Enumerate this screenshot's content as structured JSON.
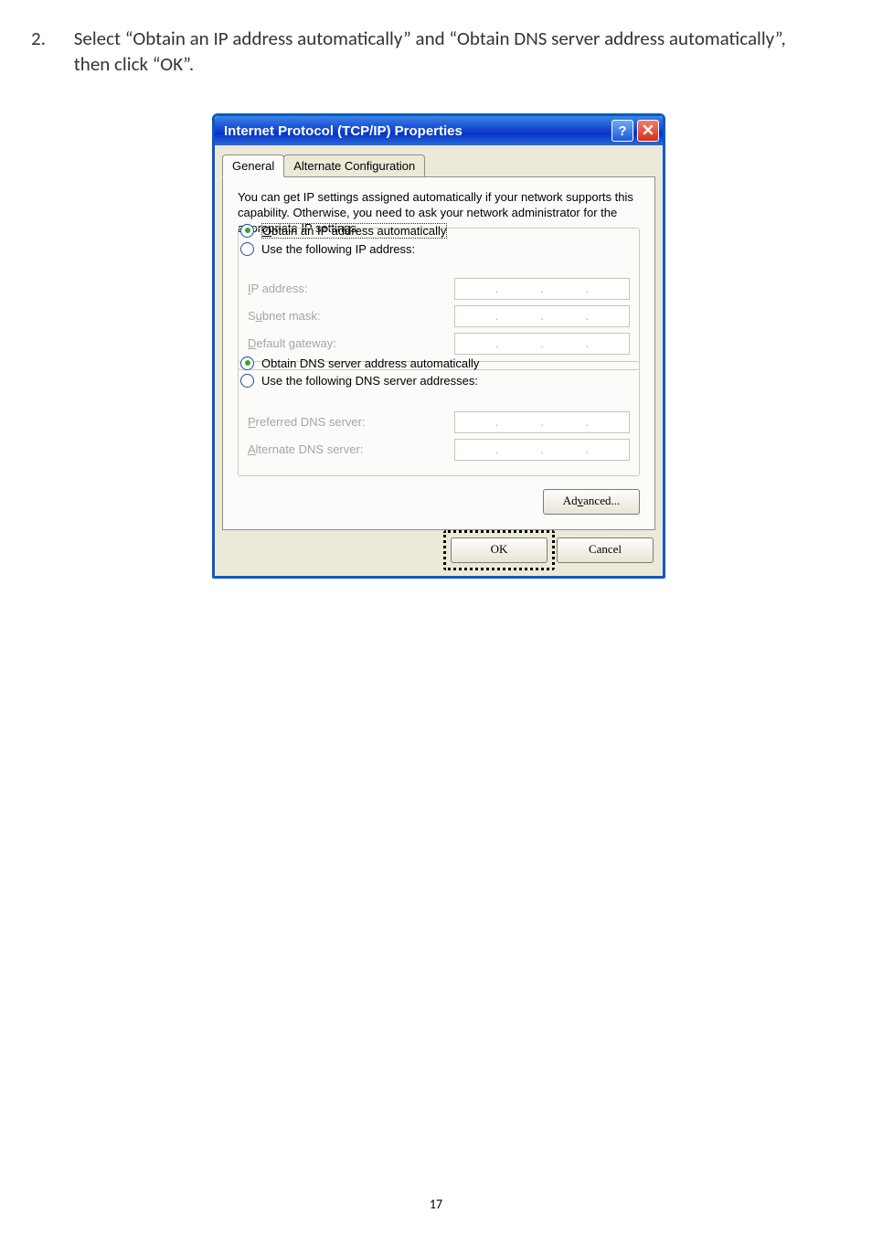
{
  "page_number": "17",
  "instruction": {
    "number": "2.",
    "text": "Select “Obtain an IP address automatically” and “Obtain DNS server address automatically”, then click “OK”."
  },
  "dialog": {
    "title": "Internet Protocol (TCP/IP) Properties",
    "help_btn": "?",
    "tabs": {
      "general": "General",
      "alt": "Alternate Configuration"
    },
    "desc": "You can get IP settings assigned automatically if your network supports this capability. Otherwise, you need to ask your network administrator for the appropriate IP settings.",
    "radios": {
      "ip_auto_prefix": "O",
      "ip_auto": "btain an IP address automatically",
      "ip_manual_prefix": "Us",
      "ip_manual": "e the following IP address:",
      "dns_auto_prefix": "Ob",
      "dns_auto": "tain DNS server address automatically",
      "dns_manual_prefix": "Us",
      "dns_manual": "e the following DNS server addresses:"
    },
    "labels": {
      "ip_addr_prefix": "I",
      "ip_addr": "P address:",
      "subnet_prefix": "S",
      "subnet_u": "u",
      "subnet_rest": "bnet mask:",
      "gateway_prefix": "D",
      "gateway": "efault gateway:",
      "pref_dns_prefix": "P",
      "pref_dns": "referred DNS server:",
      "alt_dns_prefix": "A",
      "alt_dns": "lternate DNS server:"
    },
    "buttons": {
      "advanced_prefix": "Ad",
      "advanced_u": "v",
      "advanced_rest": "anced...",
      "ok": "OK",
      "cancel": "Cancel"
    }
  }
}
